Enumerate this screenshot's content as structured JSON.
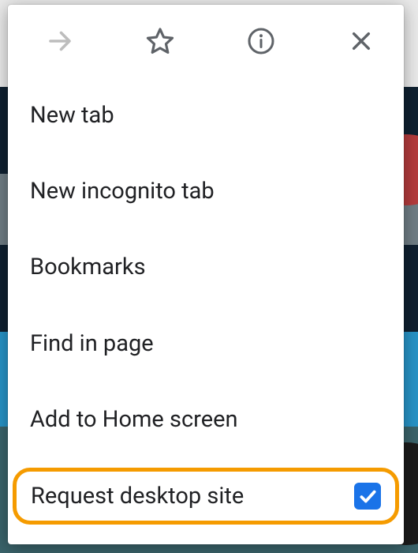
{
  "toolbar": {
    "forward_icon": "forward",
    "star_icon": "star",
    "info_icon": "info",
    "close_icon": "close"
  },
  "menu": {
    "new_tab": "New tab",
    "new_incognito_tab": "New incognito tab",
    "bookmarks": "Bookmarks",
    "find_in_page": "Find in page",
    "add_to_home_screen": "Add to Home screen",
    "request_desktop_site": "Request desktop site",
    "request_desktop_site_checked": true
  },
  "highlight": "request_desktop_site"
}
